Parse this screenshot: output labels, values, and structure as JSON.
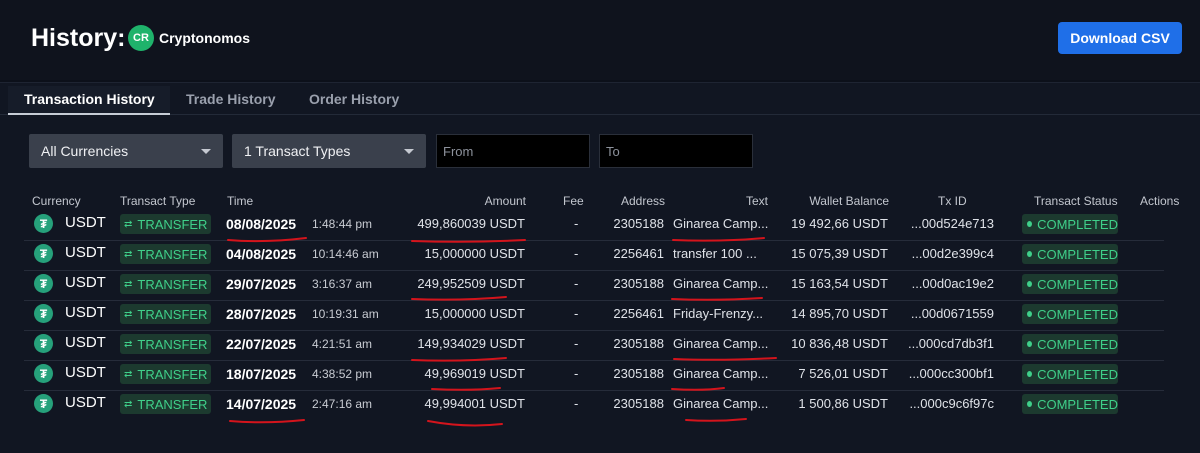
{
  "header": {
    "title": "History:",
    "account_initials": "CR",
    "account_name": "Cryptonomos",
    "download_label": "Download CSV"
  },
  "tabs": [
    {
      "label": "Transaction History",
      "active": true
    },
    {
      "label": "Trade History",
      "active": false
    },
    {
      "label": "Order History",
      "active": false
    }
  ],
  "filters": {
    "currency": "All Currencies",
    "types": "1 Transact Types",
    "from_placeholder": "From",
    "to_placeholder": "To"
  },
  "columns": {
    "currency": "Currency",
    "type": "Transact Type",
    "time": "Time",
    "amount": "Amount",
    "fee": "Fee",
    "address": "Address",
    "text": "Text",
    "balance": "Wallet Balance",
    "txid": "Tx ID",
    "status": "Transact Status",
    "actions": "Actions"
  },
  "rows": [
    {
      "currency": "USDT",
      "type": "TRANSFER",
      "date": "08/08/2025",
      "time": "1:48:44 pm",
      "amount": "499,860039 USDT",
      "fee": "-",
      "address": "2305188",
      "text": "Ginarea Camp...",
      "balance": "19 492,66 USDT",
      "txid": "...00d524e713",
      "status": "COMPLETED"
    },
    {
      "currency": "USDT",
      "type": "TRANSFER",
      "date": "04/08/2025",
      "time": "10:14:46 am",
      "amount": "15,000000 USDT",
      "fee": "-",
      "address": "2256461",
      "text": "transfer 100 ...",
      "balance": "15 075,39 USDT",
      "txid": "...00d2e399c4",
      "status": "COMPLETED"
    },
    {
      "currency": "USDT",
      "type": "TRANSFER",
      "date": "29/07/2025",
      "time": "3:16:37 am",
      "amount": "249,952509 USDT",
      "fee": "-",
      "address": "2305188",
      "text": "Ginarea Camp...",
      "balance": "15 163,54 USDT",
      "txid": "...00d0ac19e2",
      "status": "COMPLETED"
    },
    {
      "currency": "USDT",
      "type": "TRANSFER",
      "date": "28/07/2025",
      "time": "10:19:31 am",
      "amount": "15,000000 USDT",
      "fee": "-",
      "address": "2256461",
      "text": "Friday-Frenzy...",
      "balance": "14 895,70 USDT",
      "txid": "...00d0671559",
      "status": "COMPLETED"
    },
    {
      "currency": "USDT",
      "type": "TRANSFER",
      "date": "22/07/2025",
      "time": "4:21:51 am",
      "amount": "149,934029 USDT",
      "fee": "-",
      "address": "2305188",
      "text": "Ginarea Camp...",
      "balance": "10 836,48 USDT",
      "txid": "...000cd7db3f1",
      "status": "COMPLETED"
    },
    {
      "currency": "USDT",
      "type": "TRANSFER",
      "date": "18/07/2025",
      "time": "4:38:52 pm",
      "amount": "49,969019 USDT",
      "fee": "-",
      "address": "2305188",
      "text": "Ginarea Camp...",
      "balance": "7 526,01 USDT",
      "txid": "...000cc300bf1",
      "status": "COMPLETED"
    },
    {
      "currency": "USDT",
      "type": "TRANSFER",
      "date": "14/07/2025",
      "time": "2:47:16 am",
      "amount": "49,994001 USDT",
      "fee": "-",
      "address": "2305188",
      "text": "Ginarea Camp...",
      "balance": "1 500,86 USDT",
      "txid": "...000c9c6f97c",
      "status": "COMPLETED"
    }
  ],
  "colors": {
    "accent": "#1f6fe8",
    "status_green": "#3fd08a",
    "annotation_red": "#d4141c",
    "tether": "#26a17b"
  },
  "icons": {
    "currency": "tether-icon",
    "type": "transfer-arrows-icon",
    "status": "status-dot-icon",
    "dropdown": "chevron-down-icon"
  }
}
